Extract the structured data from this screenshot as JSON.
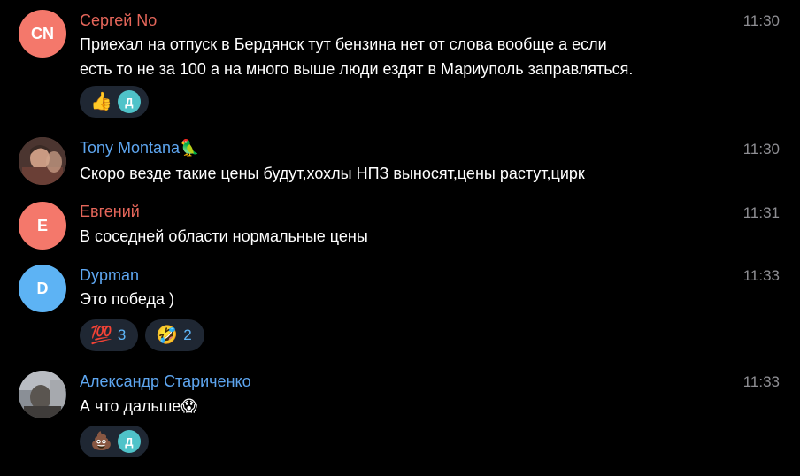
{
  "messages": [
    {
      "author": "Сергей No",
      "avatar_initials": "CN",
      "avatar_color": "#f4786b",
      "name_color": "#e5665a",
      "time": "11:30",
      "text_lines": [
        "Приехал на отпуск в Бердянск тут бензина нет от слова вообще а если",
        "есть то не за 100 а на много выше люди ездят в Мариуполь заправляться."
      ],
      "reactions": [
        {
          "emoji": "👍",
          "avatar_letter": "Д"
        }
      ]
    },
    {
      "author": "Tony Montana",
      "author_badge": "🦜",
      "avatar_photo": "photo",
      "name_color": "#5ea6f0",
      "time": "11:30",
      "text": "Скоро везде такие цены будут,хохлы НПЗ выносят,цены растут,цирк"
    },
    {
      "author": "Евгений",
      "avatar_initials": "Е",
      "avatar_color": "#f4786b",
      "name_color": "#e5665a",
      "time": "11:31",
      "text": "В соседней области нормальные цены"
    },
    {
      "author": "Dypman",
      "avatar_initials": "D",
      "avatar_color": "#5db3f4",
      "name_color": "#5ea6f0",
      "time": "11:33",
      "text": "Это победа )",
      "reactions": [
        {
          "emoji": "💯",
          "count": "3"
        },
        {
          "emoji": "🤣",
          "count": "2"
        }
      ]
    },
    {
      "author": "Александр Стариченко",
      "avatar_photo": "photo",
      "name_color": "#5ea6f0",
      "time": "11:33",
      "text": "А что дальше",
      "text_emoji": "😱",
      "reactions": [
        {
          "emoji": "💩",
          "avatar_letter": "Д"
        }
      ]
    }
  ]
}
